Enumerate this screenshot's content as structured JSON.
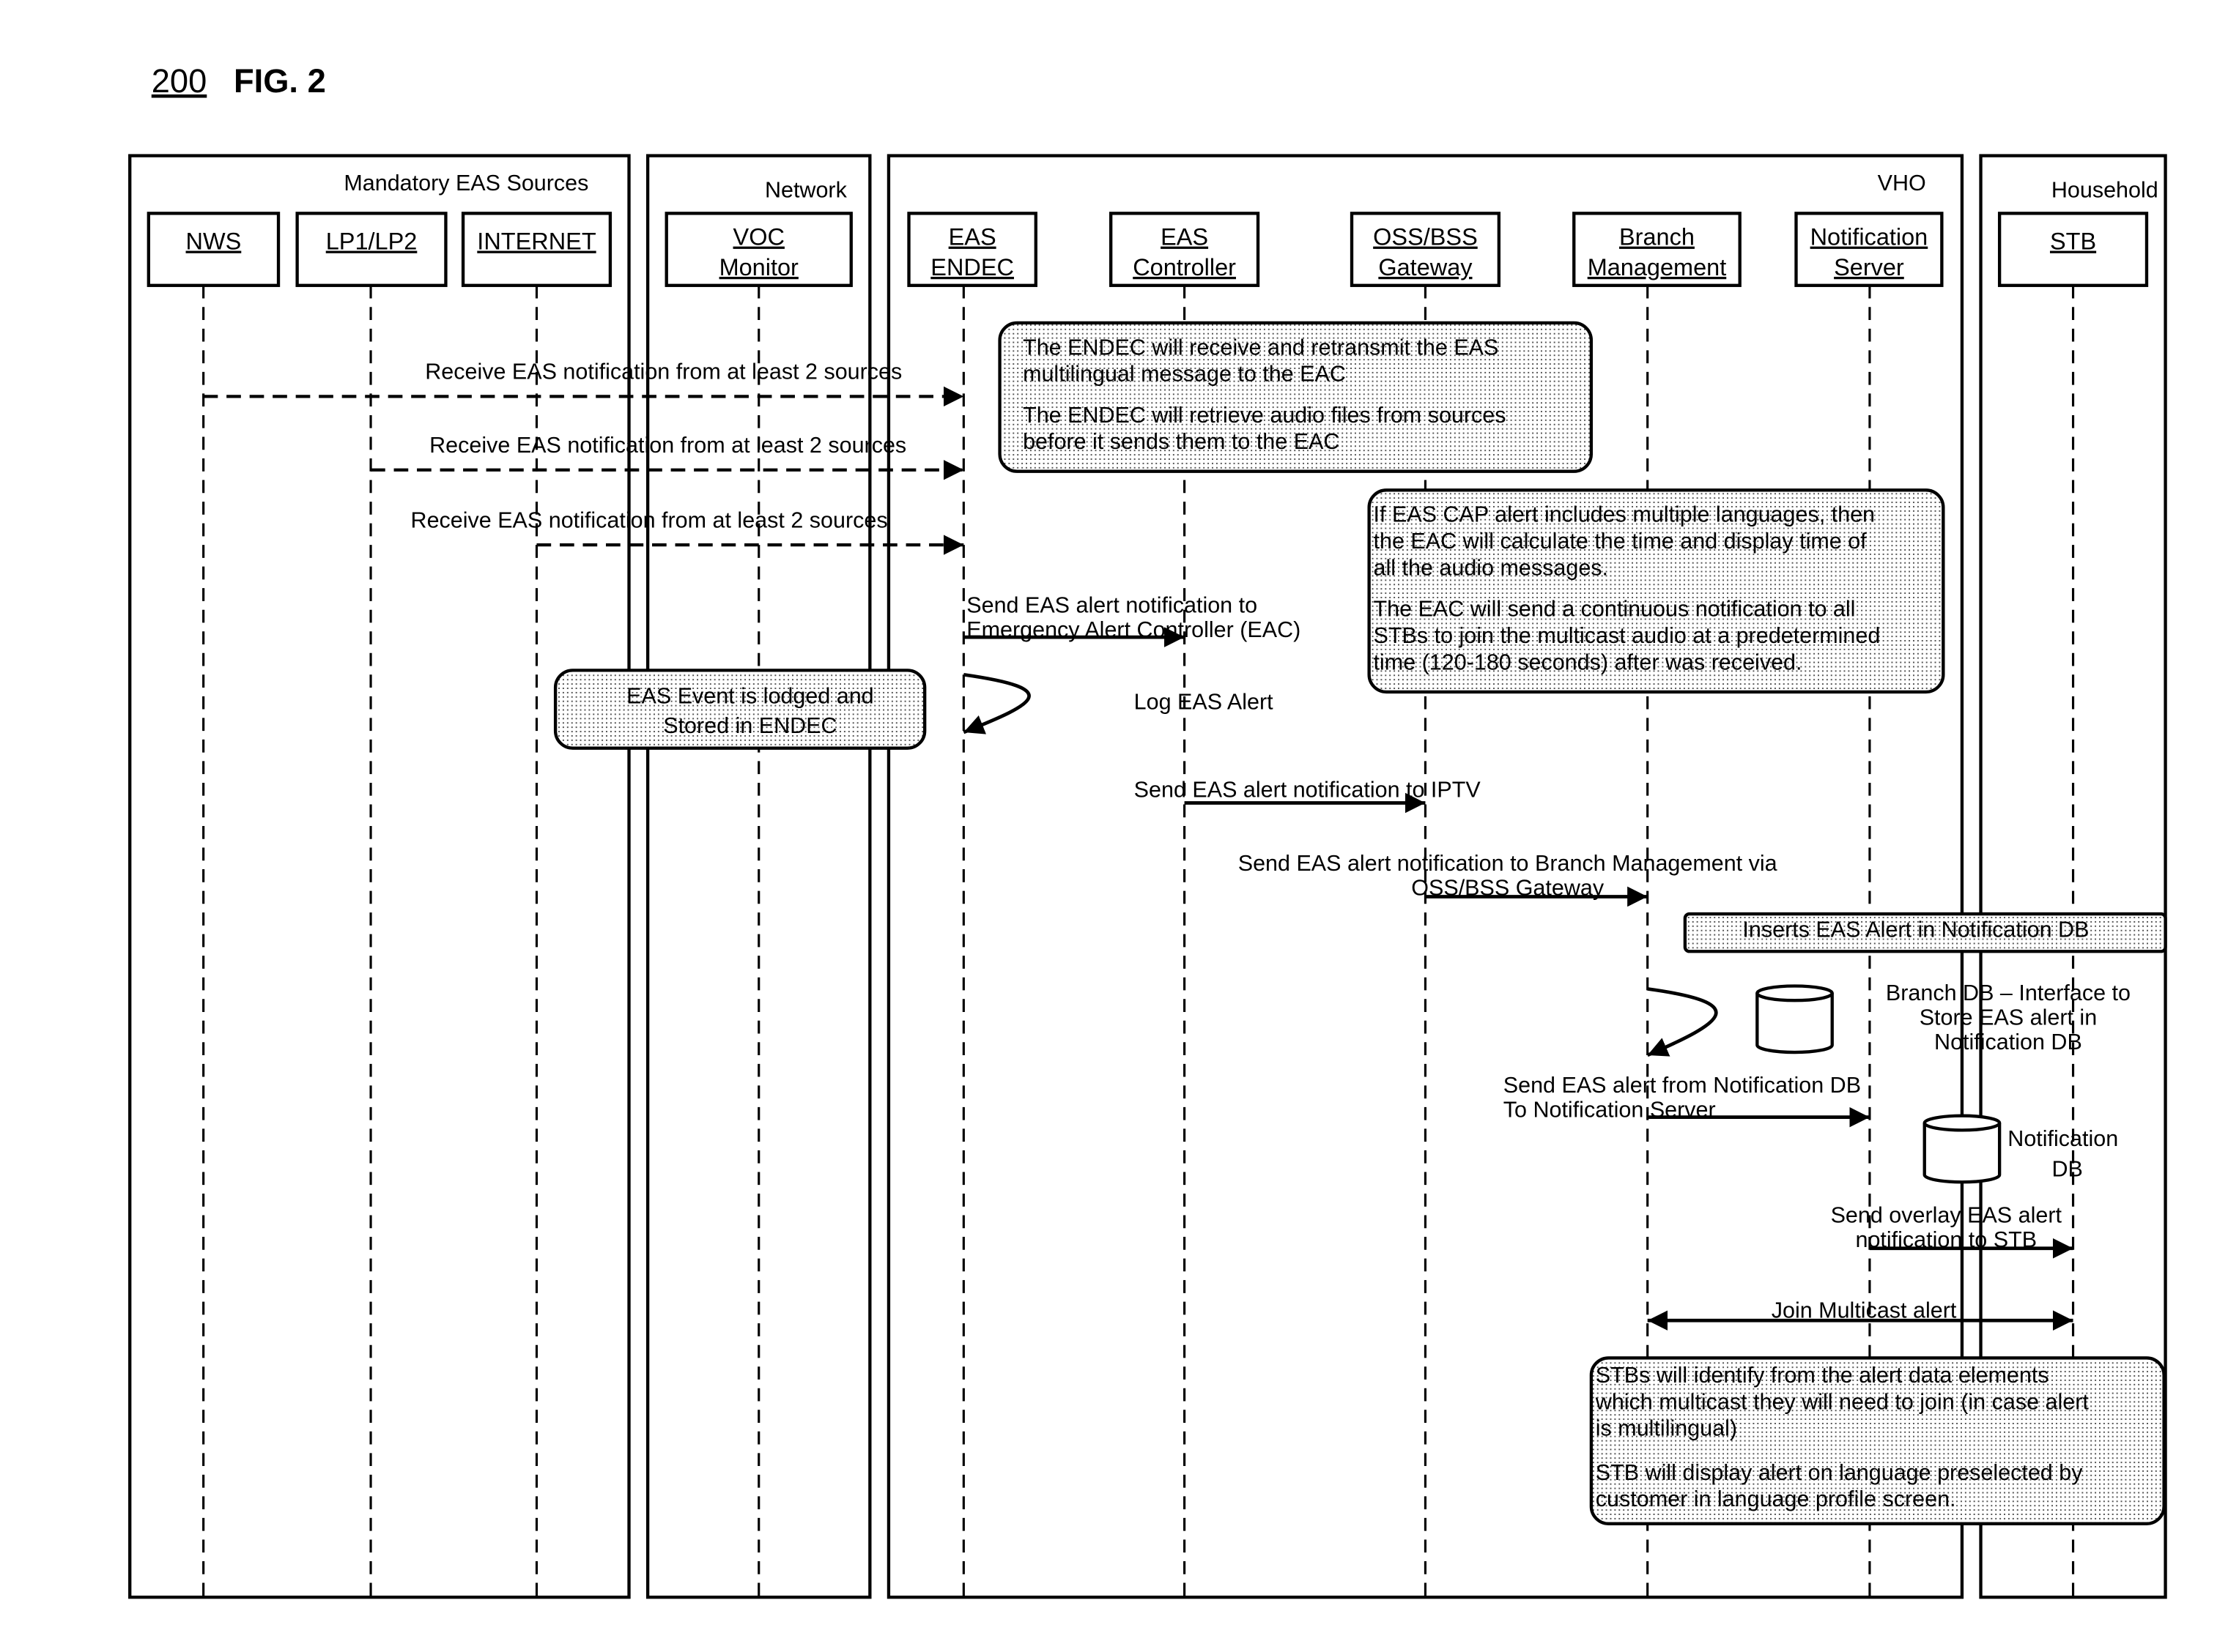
{
  "figure": {
    "ref_number": "200",
    "title": "FIG. 2"
  },
  "groups": [
    {
      "id": "sources",
      "label": "Mandatory EAS Sources"
    },
    {
      "id": "network",
      "label": "Network"
    },
    {
      "id": "vho",
      "label": "VHO"
    },
    {
      "id": "household",
      "label": "Household"
    }
  ],
  "participants": [
    {
      "id": "nws",
      "lines": [
        "NWS"
      ]
    },
    {
      "id": "lp",
      "lines": [
        "LP1/LP2"
      ]
    },
    {
      "id": "internet",
      "lines": [
        "INTERNET"
      ]
    },
    {
      "id": "voc",
      "lines": [
        "VOC",
        "Monitor"
      ]
    },
    {
      "id": "endec",
      "lines": [
        "EAS",
        "ENDEC"
      ]
    },
    {
      "id": "controller",
      "lines": [
        "EAS",
        "Controller"
      ]
    },
    {
      "id": "oss",
      "lines": [
        "OSS/BSS",
        "Gateway"
      ]
    },
    {
      "id": "branch",
      "lines": [
        "Branch",
        "Management"
      ]
    },
    {
      "id": "notifserver",
      "lines": [
        "Notification",
        "Server"
      ]
    },
    {
      "id": "stb",
      "lines": [
        "STB"
      ]
    }
  ],
  "messages": [
    {
      "id": "m1",
      "from": "nws",
      "to": "endec",
      "style": "dashed",
      "lines": [
        "Receive EAS notification from at least 2 sources"
      ]
    },
    {
      "id": "m2",
      "from": "lp",
      "to": "endec",
      "style": "dashed",
      "lines": [
        "Receive EAS notification from at least 2 sources"
      ]
    },
    {
      "id": "m3",
      "from": "internet",
      "to": "endec",
      "style": "dashed",
      "lines": [
        "Receive EAS notification from at least 2 sources"
      ]
    },
    {
      "id": "m4",
      "from": "endec",
      "to": "controller",
      "style": "solid",
      "lines": [
        "Send EAS alert notification to",
        "Emergency Alert Controller (EAC)"
      ]
    },
    {
      "id": "m5",
      "from": "endec",
      "to": "endec",
      "style": "self",
      "lines": [
        "Log EAS Alert"
      ]
    },
    {
      "id": "m6",
      "from": "controller",
      "to": "oss",
      "style": "solid",
      "lines": [
        "Send EAS alert notification to IPTV"
      ]
    },
    {
      "id": "m7",
      "from": "oss",
      "to": "branch",
      "style": "solid",
      "lines": [
        "Send EAS alert notification to Branch Management via",
        "OSS/BSS Gateway"
      ]
    },
    {
      "id": "m8",
      "from": "branch",
      "to": "branch",
      "style": "self",
      "lines": [
        "Branch DB – Interface to",
        "Store EAS alert in",
        "Notification DB"
      ]
    },
    {
      "id": "m9",
      "from": "branch",
      "to": "notifserver",
      "style": "solid",
      "lines": [
        "Send EAS alert from Notification DB",
        "To Notification Server"
      ]
    },
    {
      "id": "m10",
      "from": "notifserver",
      "to": "stb",
      "style": "solid",
      "lines": [
        "Send overlay EAS alert",
        "notification to STB"
      ]
    },
    {
      "id": "m11",
      "from": "branch",
      "to": "stb",
      "style": "bidirectional",
      "lines": [
        "Join Multicast alert"
      ]
    }
  ],
  "notes": [
    {
      "id": "endec-note",
      "paragraphs": [
        [
          "The ENDEC will receive and  retransmit the EAS",
          "multilingual message to the EAC"
        ],
        [
          "The ENDEC will retrieve audio files from sources",
          "before it sends them to  the EAC"
        ]
      ]
    },
    {
      "id": "eac-note",
      "paragraphs": [
        [
          "If EAS CAP alert includes multiple languages, then",
          "the EAC will calculate the time and display time of",
          "all the audio messages."
        ],
        [
          "The EAC will send a continuous notification to all",
          "STBs to join the multicast audio at a predetermined",
          "time (120-180 seconds) after was received."
        ]
      ]
    },
    {
      "id": "voc-note",
      "paragraphs": [
        [
          "EAS Event is lodged and",
          "Stored in ENDEC"
        ]
      ]
    },
    {
      "id": "insert-note",
      "paragraphs": [
        [
          "Inserts EAS Alert in Notification DB"
        ]
      ]
    },
    {
      "id": "stb-note",
      "paragraphs": [
        [
          "STBs will identify from the alert data elements",
          "which multicast they will need to join (in case alert",
          "is multilingual)"
        ],
        [
          "STB will display alert on language preselected by",
          "customer in language profile screen."
        ]
      ]
    }
  ],
  "databases": [
    {
      "id": "branch-db",
      "lines": []
    },
    {
      "id": "notification-db",
      "lines": [
        "Notification",
        "DB"
      ]
    }
  ]
}
